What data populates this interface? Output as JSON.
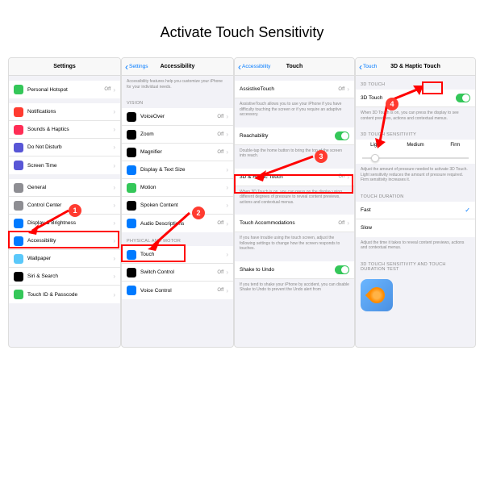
{
  "title": "Activate Touch Sensitivity",
  "p1": {
    "header": "Settings",
    "rows": [
      {
        "icon": "#34c759",
        "label": "Personal Hotspot",
        "value": "Off"
      },
      {
        "icon": "#ff3b30",
        "label": "Notifications"
      },
      {
        "icon": "#ff2d55",
        "label": "Sounds & Haptics"
      },
      {
        "icon": "#5856d6",
        "label": "Do Not Disturb"
      },
      {
        "icon": "#5856d6",
        "label": "Screen Time"
      },
      {
        "icon": "#8e8e93",
        "label": "General"
      },
      {
        "icon": "#8e8e93",
        "label": "Control Center"
      },
      {
        "icon": "#007aff",
        "label": "Display & Brightness"
      },
      {
        "icon": "#007aff",
        "label": "Accessibility"
      },
      {
        "icon": "#5ac8fa",
        "label": "Wallpaper"
      },
      {
        "icon": "#000",
        "label": "Siri & Search"
      },
      {
        "icon": "#34c759",
        "label": "Touch ID & Passcode"
      }
    ]
  },
  "p2": {
    "back": "Settings",
    "header": "Accessibility",
    "desc": "Accessibility features help you customize your iPhone for your individual needs.",
    "sec1": "VISION",
    "rows1": [
      {
        "icon": "#000",
        "label": "VoiceOver",
        "value": "Off"
      },
      {
        "icon": "#000",
        "label": "Zoom",
        "value": "Off"
      },
      {
        "icon": "#000",
        "label": "Magnifier",
        "value": "Off"
      },
      {
        "icon": "#007aff",
        "label": "Display & Text Size"
      },
      {
        "icon": "#34c759",
        "label": "Motion"
      },
      {
        "icon": "#000",
        "label": "Spoken Content"
      },
      {
        "icon": "#007aff",
        "label": "Audio Descriptions",
        "value": "Off"
      }
    ],
    "sec2": "PHYSICAL AND MOTOR",
    "rows2": [
      {
        "icon": "#007aff",
        "label": "Touch"
      },
      {
        "icon": "#000",
        "label": "Switch Control",
        "value": "Off"
      },
      {
        "icon": "#007aff",
        "label": "Voice Control",
        "value": "Off"
      }
    ]
  },
  "p3": {
    "back": "Accessibility",
    "header": "Touch",
    "items": [
      {
        "label": "AssistiveTouch",
        "value": "Off",
        "desc": "AssistiveTouch allows you to use your iPhone if you have difficulty touching the screen or if you require an adaptive accessory."
      },
      {
        "label": "Reachability",
        "toggle": true,
        "desc": "Double-tap the home button to bring the top of the screen into reach."
      },
      {
        "label": "3D & Haptic Touch",
        "value": "On",
        "desc": "When 3D Touch is on, you can press on the display using different degrees of pressure to reveal content previews, actions and contextual menus."
      },
      {
        "label": "Touch Accommodations",
        "value": "Off",
        "desc": "If you have trouble using the touch screen, adjust the following settings to change how the screen responds to touches."
      },
      {
        "label": "Shake to Undo",
        "toggle": true,
        "desc": "If you tend to shake your iPhone by accident, you can disable Shake to Undo to prevent the Undo alert from"
      }
    ]
  },
  "p4": {
    "back": "Touch",
    "header": "3D & Haptic Touch",
    "sec1": "3D TOUCH",
    "toggle_label": "3D Touch",
    "toggle_desc": "When 3D Touch is on, you can press the display to see content previews, actions and contextual menus.",
    "sec2": "3D TOUCH SENSITIVITY",
    "seg": [
      "Light",
      "Medium",
      "Firm"
    ],
    "seg_desc": "Adjust the amount of pressure needed to activate 3D Touch. Light sensitivity reduces the amount of pressure required. Firm sensitivity increases it.",
    "sec3": "TOUCH DURATION",
    "dur": [
      {
        "label": "Fast",
        "check": true
      },
      {
        "label": "Slow"
      }
    ],
    "dur_desc": "Adjust the time it takes to reveal content previews, actions and contextual menus.",
    "sec4": "3D TOUCH SENSITIVITY AND TOUCH DURATION TEST"
  },
  "badges": [
    "1",
    "2",
    "3",
    "4"
  ]
}
